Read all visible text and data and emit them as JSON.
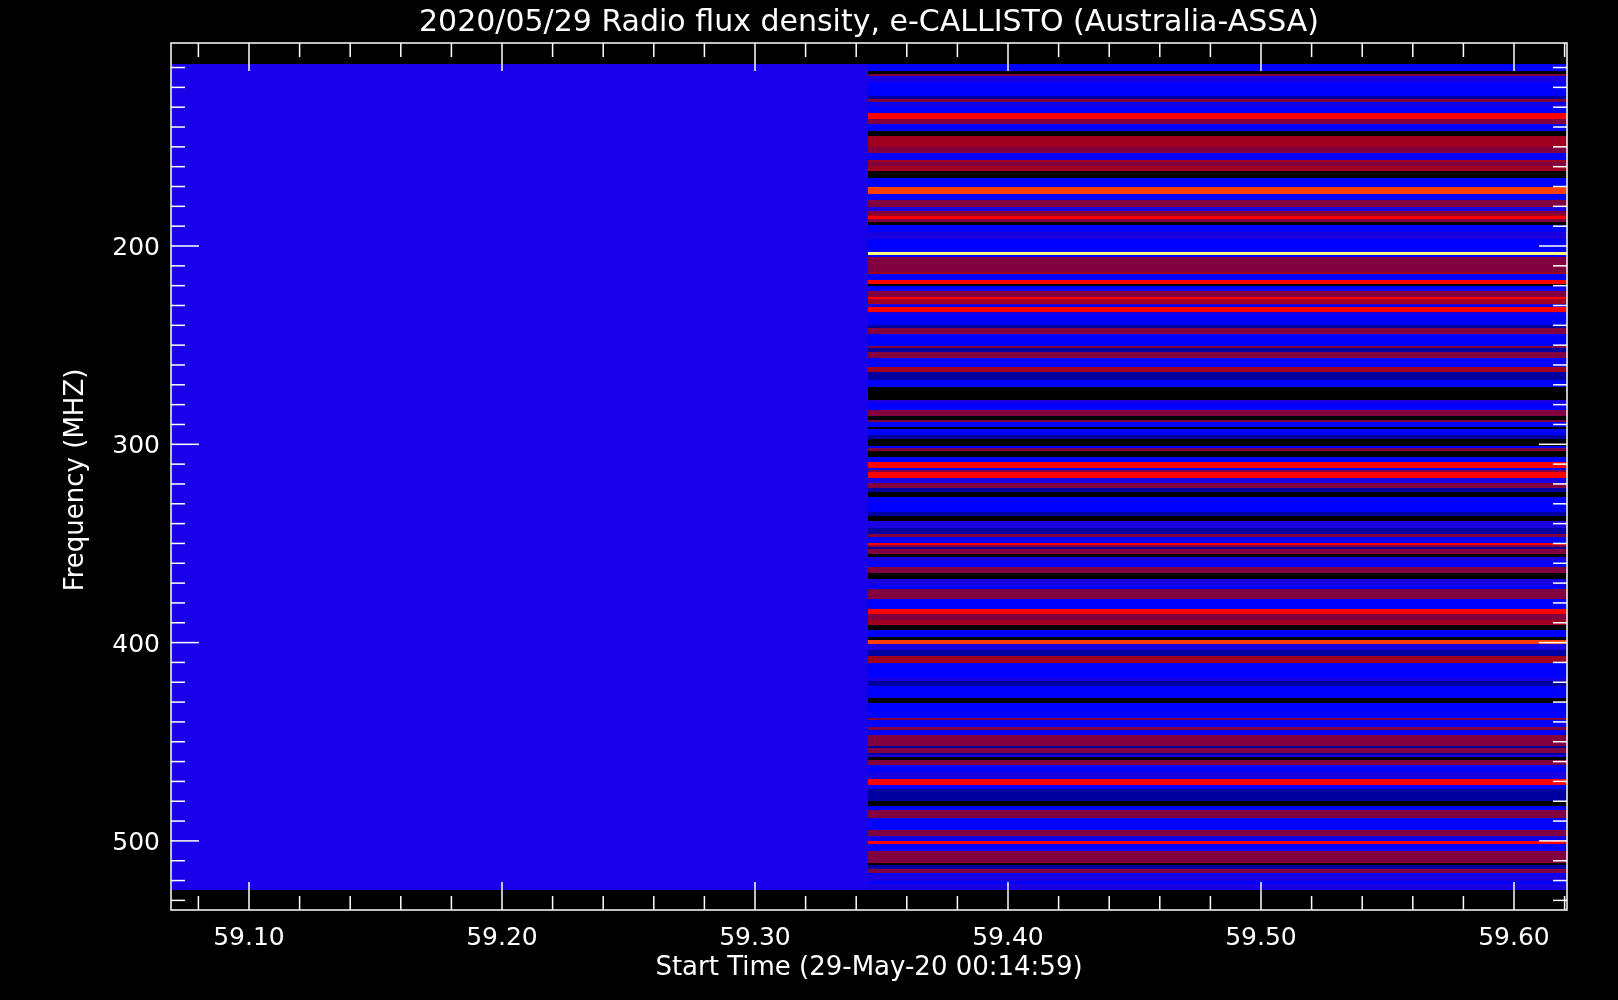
{
  "title": "2020/05/29  Radio flux density, e-CALLISTO (Australia-ASSA)",
  "y_axis": {
    "label": "Frequency (MHZ)",
    "ticks": [
      "200",
      "300",
      "400",
      "500"
    ]
  },
  "x_axis": {
    "label": "Start Time (29-May-20 00:14:59)",
    "ticks": [
      "59.10",
      "59.20",
      "59.30",
      "59.40",
      "59.50",
      "59.60"
    ]
  }
}
